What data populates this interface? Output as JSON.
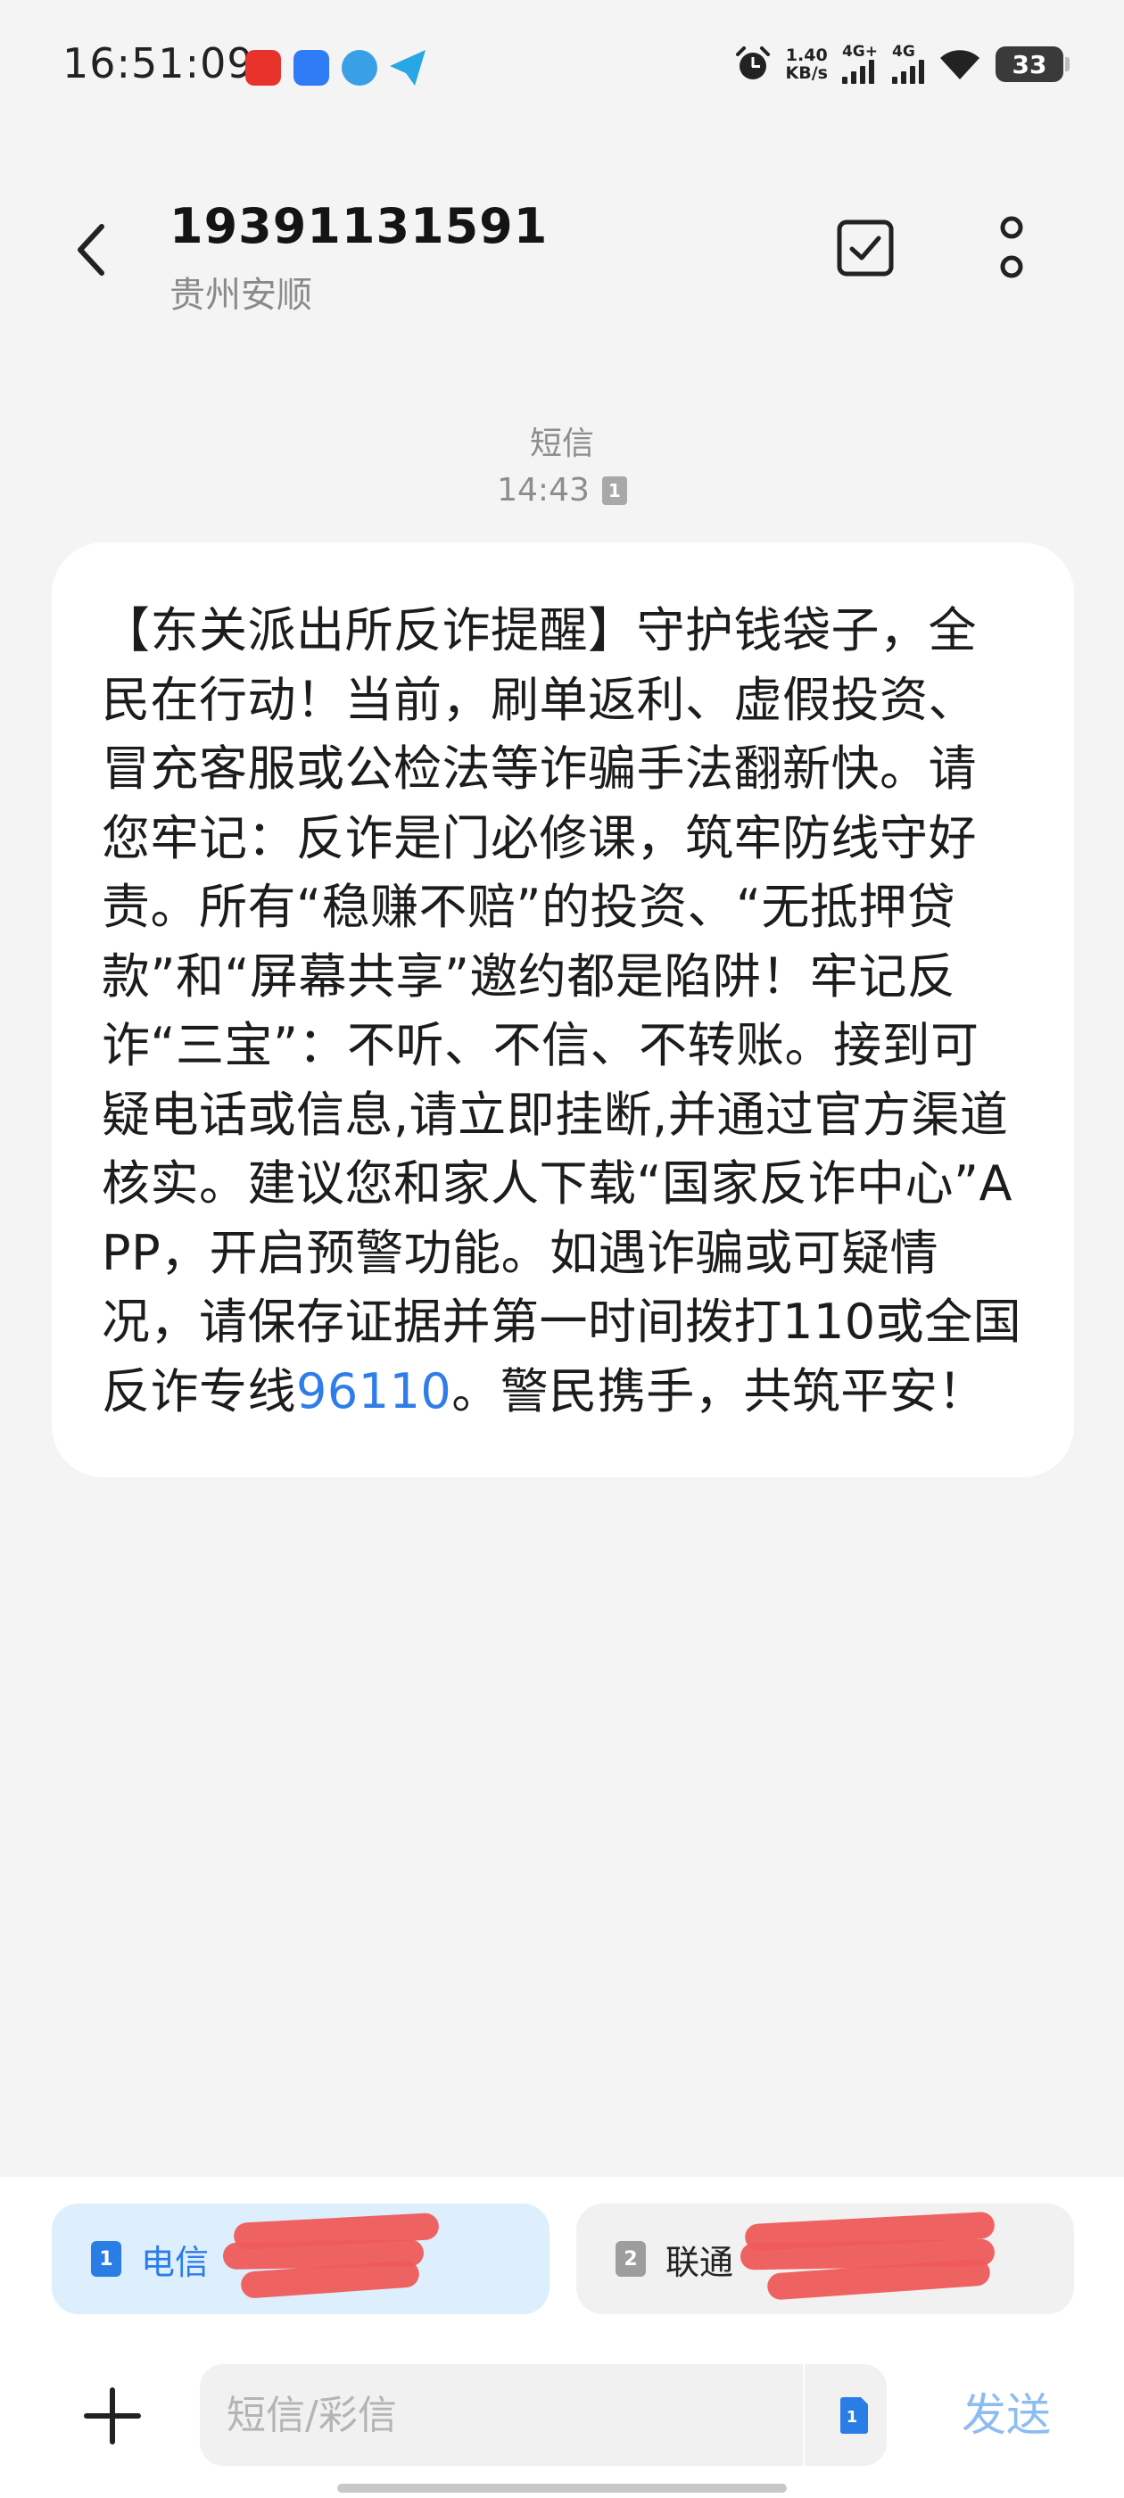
{
  "status_bar": {
    "time": "16:51:09",
    "net_speed_value": "1.40",
    "net_speed_unit": "KB/s",
    "signal1_label": "4G+",
    "signal2_label": "4G",
    "battery": "33"
  },
  "header": {
    "phone_number": "19391131591",
    "location": "贵州安顺"
  },
  "conversation": {
    "message_type": "短信",
    "time": "14:43",
    "sim_slot": "1",
    "message_text_before_link": "【东关派出所反诈提醒】守护钱袋子，全民在行动！当前，刷单返利、虚假投资、冒充客服或公检法等诈骗手法翻新快。请您牢记：反诈是门必修课，筑牢防线守好责。所有“稳赚不赔”的投资、“无抵押贷款”和“屏幕共享”邀约都是陷阱！牢记反诈“三宝”：不听、不信、不转账。接到可疑电话或信息,请立即挂断,并通过官方渠道核实。建议您和家人下载“国家反诈中心”APP，开启预警功能。如遇诈骗或可疑情况，请保存证据并第一时间拨打110或全国反诈专线",
    "message_link": "96110",
    "message_text_after_link": "。警民携手，共筑平安！"
  },
  "sim_selector": {
    "sim1_badge": "1",
    "sim1_label": "电信",
    "sim2_badge": "2",
    "sim2_label": "联通"
  },
  "composer": {
    "placeholder": "短信/彩信",
    "send_label": "发送"
  },
  "colors": {
    "accent": "#2b7de6",
    "send_disabled": "#8dbcf2",
    "background": "#f4f4f5",
    "bubble": "#ffffff"
  }
}
